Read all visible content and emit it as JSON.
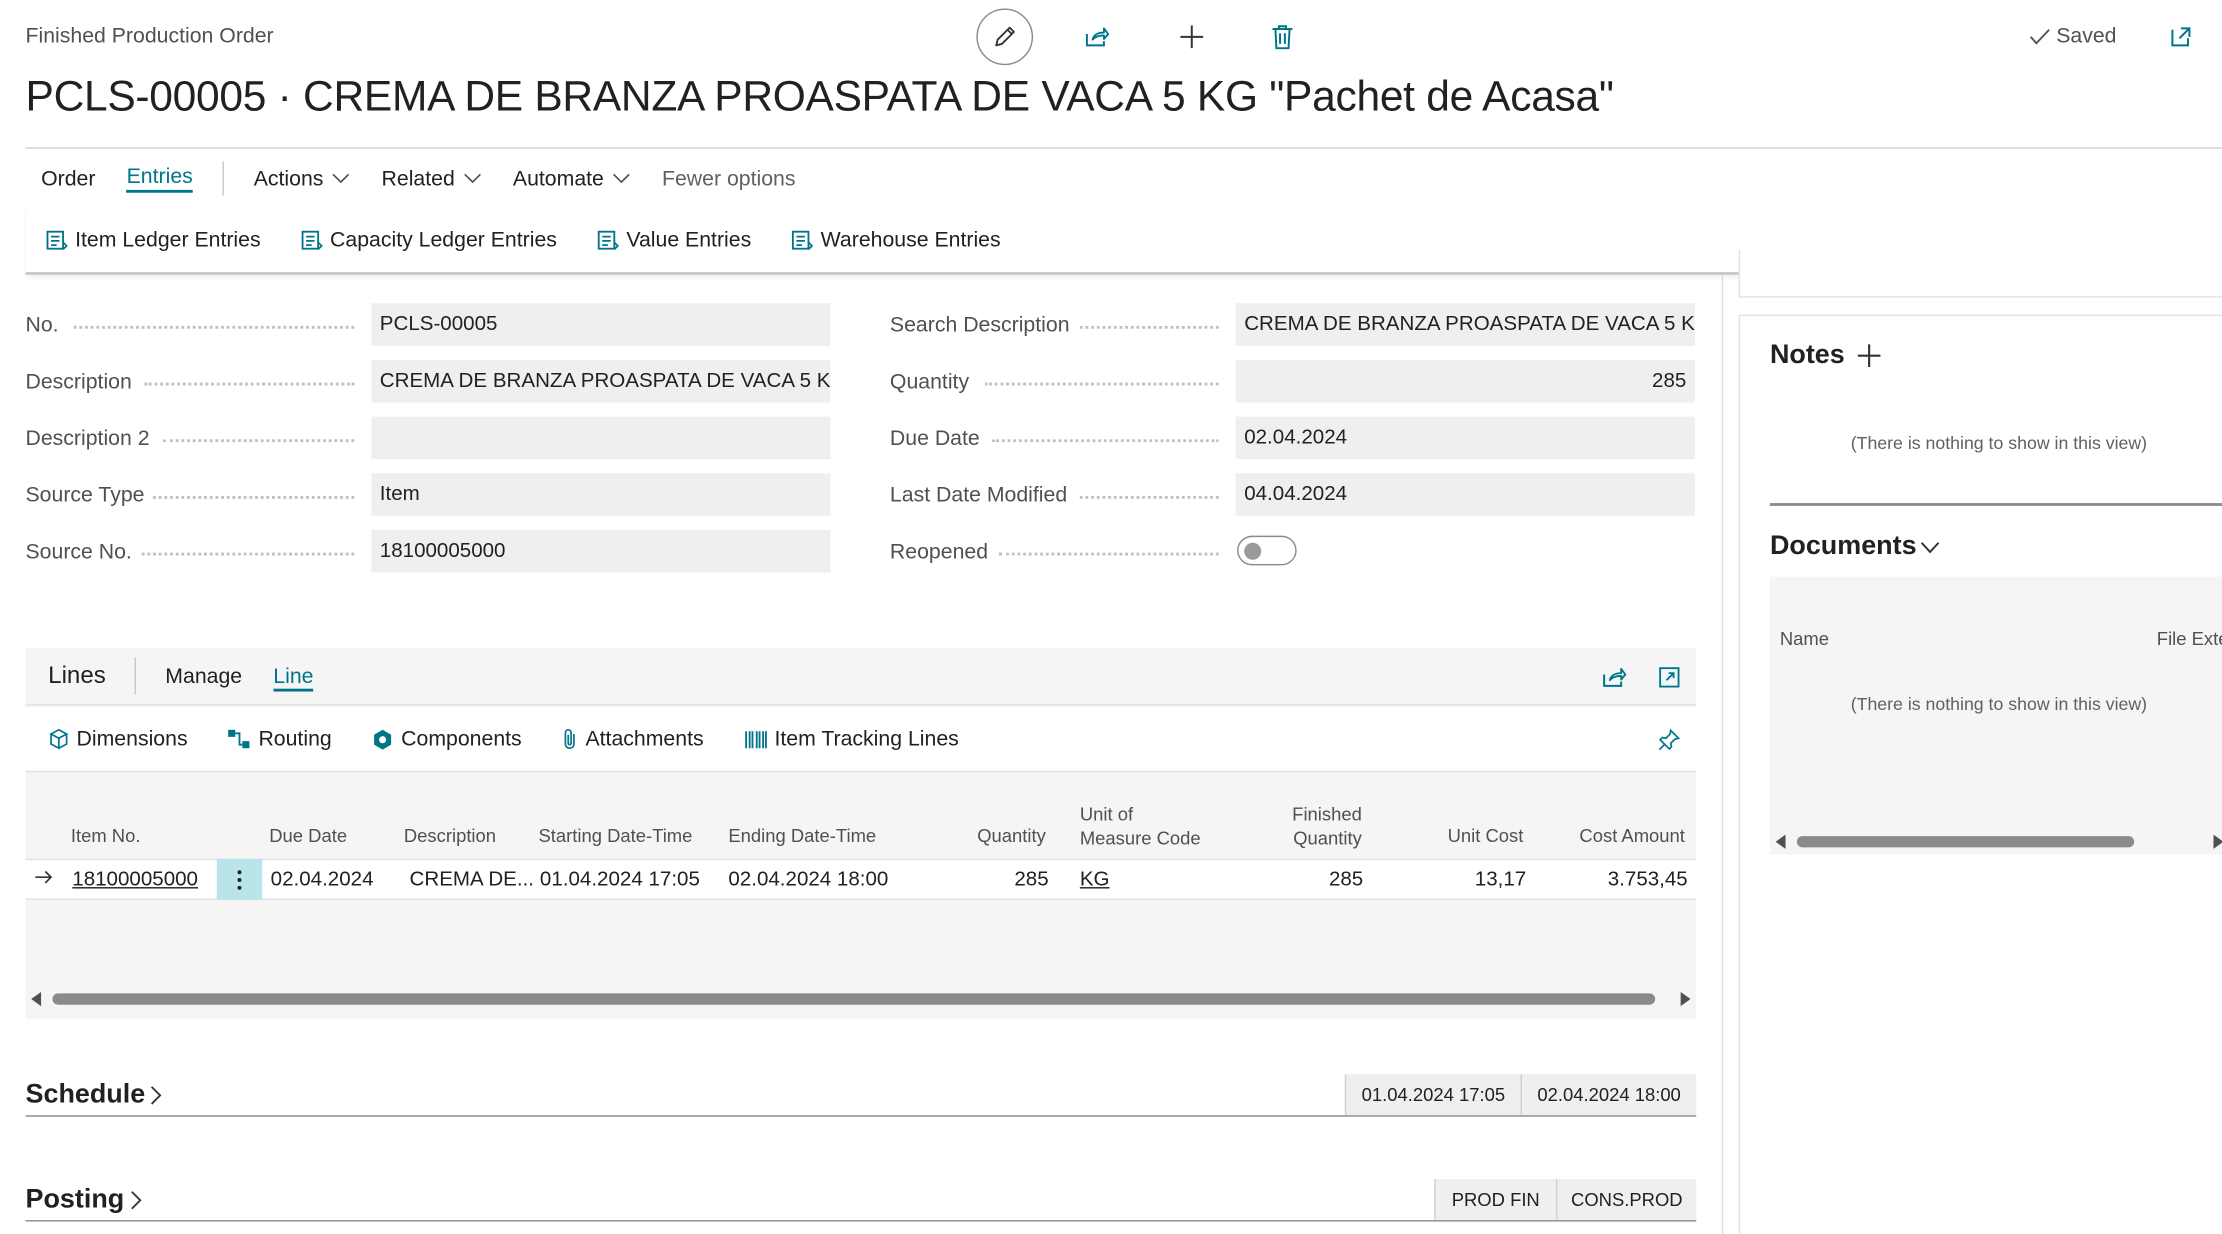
{
  "header": {
    "breadcrumb": "Finished Production Order",
    "title": "PCLS-00005 · CREMA DE BRANZA PROASPATA DE VACA 5 KG \"Pachet de Acasa\"",
    "saved_label": "Saved"
  },
  "actionbar": {
    "tabs": [
      "Order",
      "Entries"
    ],
    "menus": [
      "Actions",
      "Related",
      "Automate"
    ],
    "fewer": "Fewer options"
  },
  "entries_bar": [
    "Item Ledger Entries",
    "Capacity Ledger Entries",
    "Value Entries",
    "Warehouse Entries"
  ],
  "general": {
    "no_label": "No.",
    "no_value": "PCLS-00005",
    "description_label": "Description",
    "description_value": "CREMA DE BRANZA PROASPATA DE VACA 5 K...",
    "description2_label": "Description 2",
    "description2_value": "",
    "source_type_label": "Source Type",
    "source_type_value": "Item",
    "source_no_label": "Source No.",
    "source_no_value": "18100005000",
    "search_description_label": "Search Description",
    "search_description_value": "CREMA DE BRANZA PROASPATA DE VACA 5 K...",
    "quantity_label": "Quantity",
    "quantity_value": "285",
    "due_date_label": "Due Date",
    "due_date_value": "02.04.2024",
    "last_modified_label": "Last Date Modified",
    "last_modified_value": "04.04.2024",
    "reopened_label": "Reopened",
    "reopened_value": false
  },
  "lines": {
    "title": "Lines",
    "tabs": [
      "Manage",
      "Line"
    ],
    "tools": [
      "Dimensions",
      "Routing",
      "Components",
      "Attachments",
      "Item Tracking Lines"
    ],
    "columns": {
      "item_no": "Item No.",
      "due_date": "Due Date",
      "description": "Description",
      "starting": "Starting Date-Time",
      "ending": "Ending Date-Time",
      "quantity": "Quantity",
      "uom_1": "Unit of",
      "uom_2": "Measure Code",
      "finished_1": "Finished",
      "finished_2": "Quantity",
      "unit_cost": "Unit Cost",
      "cost_amount": "Cost Amount"
    },
    "row": {
      "item_no": "18100005000",
      "due_date": "02.04.2024",
      "description": "CREMA DE...",
      "starting": "01.04.2024 17:05",
      "ending": "02.04.2024 18:00",
      "quantity": "285",
      "uom": "KG",
      "finished": "285",
      "unit_cost": "13,17",
      "cost_amount": "3.753,45"
    }
  },
  "schedule": {
    "title": "Schedule",
    "chip1": "01.04.2024 17:05",
    "chip2": "02.04.2024 18:00"
  },
  "posting": {
    "title": "Posting",
    "chip1": "PROD FIN",
    "chip2": "CONS.PROD"
  },
  "factbox": {
    "notes_title": "Notes",
    "notes_empty": "(There is nothing to show in this view)",
    "documents_title": "Documents",
    "documents_col_name": "Name",
    "documents_col_ext": "File Exte",
    "documents_empty": "(There is nothing to show in this view)"
  },
  "colors": {
    "accent": "#00758a",
    "field_bg": "#efefef",
    "selected_cell": "#b8e4ea"
  }
}
